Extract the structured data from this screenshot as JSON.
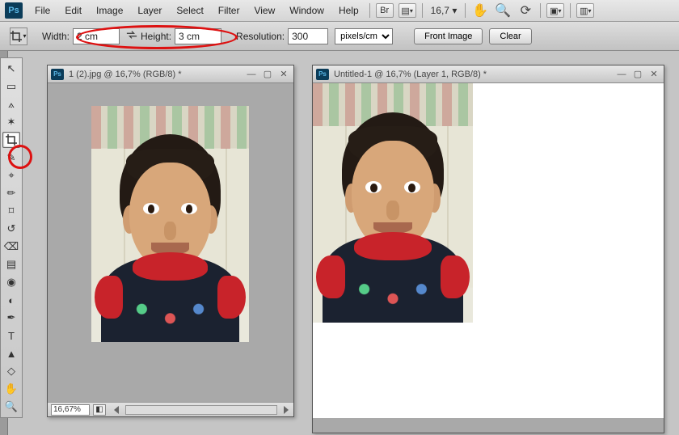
{
  "menubar": {
    "items": [
      "File",
      "Edit",
      "Image",
      "Layer",
      "Select",
      "Filter",
      "View",
      "Window",
      "Help"
    ],
    "bridge_label": "Br",
    "zoom": "16,7",
    "dropdown_arrow": "▾"
  },
  "optbar": {
    "width_label": "Width:",
    "width_value": "2 cm",
    "height_label": "Height:",
    "height_value": "3 cm",
    "resolution_label": "Resolution:",
    "resolution_value": "300",
    "units": "pixels/cm",
    "front_image": "Front Image",
    "clear": "Clear"
  },
  "tools": [
    {
      "name": "move-tool",
      "glyph": "↖"
    },
    {
      "name": "marquee-tool",
      "glyph": "▭"
    },
    {
      "name": "lasso-tool",
      "glyph": "⟑"
    },
    {
      "name": "magic-wand-tool",
      "glyph": "✶"
    },
    {
      "name": "crop-tool",
      "glyph": "✂",
      "active": true
    },
    {
      "name": "eyedropper-tool",
      "glyph": "✎"
    },
    {
      "name": "healing-brush-tool",
      "glyph": "⌖"
    },
    {
      "name": "brush-tool",
      "glyph": "✏"
    },
    {
      "name": "clone-stamp-tool",
      "glyph": "⌑"
    },
    {
      "name": "history-brush-tool",
      "glyph": "↺"
    },
    {
      "name": "eraser-tool",
      "glyph": "⌫"
    },
    {
      "name": "gradient-tool",
      "glyph": "▤"
    },
    {
      "name": "blur-tool",
      "glyph": "◉"
    },
    {
      "name": "dodge-tool",
      "glyph": "◐"
    },
    {
      "name": "pen-tool",
      "glyph": "✒"
    },
    {
      "name": "type-tool",
      "glyph": "T"
    },
    {
      "name": "path-selection-tool",
      "glyph": "▲"
    },
    {
      "name": "rectangle-tool",
      "glyph": "◇"
    },
    {
      "name": "hand-tool",
      "glyph": "✋"
    },
    {
      "name": "zoom-tool",
      "glyph": "🔍"
    }
  ],
  "doc1": {
    "title": "1 (2).jpg @ 16,7% (RGB/8) *",
    "status_zoom": "16,67%"
  },
  "doc2": {
    "title": "Untitled-1 @ 16,7% (Layer 1, RGB/8) *"
  }
}
